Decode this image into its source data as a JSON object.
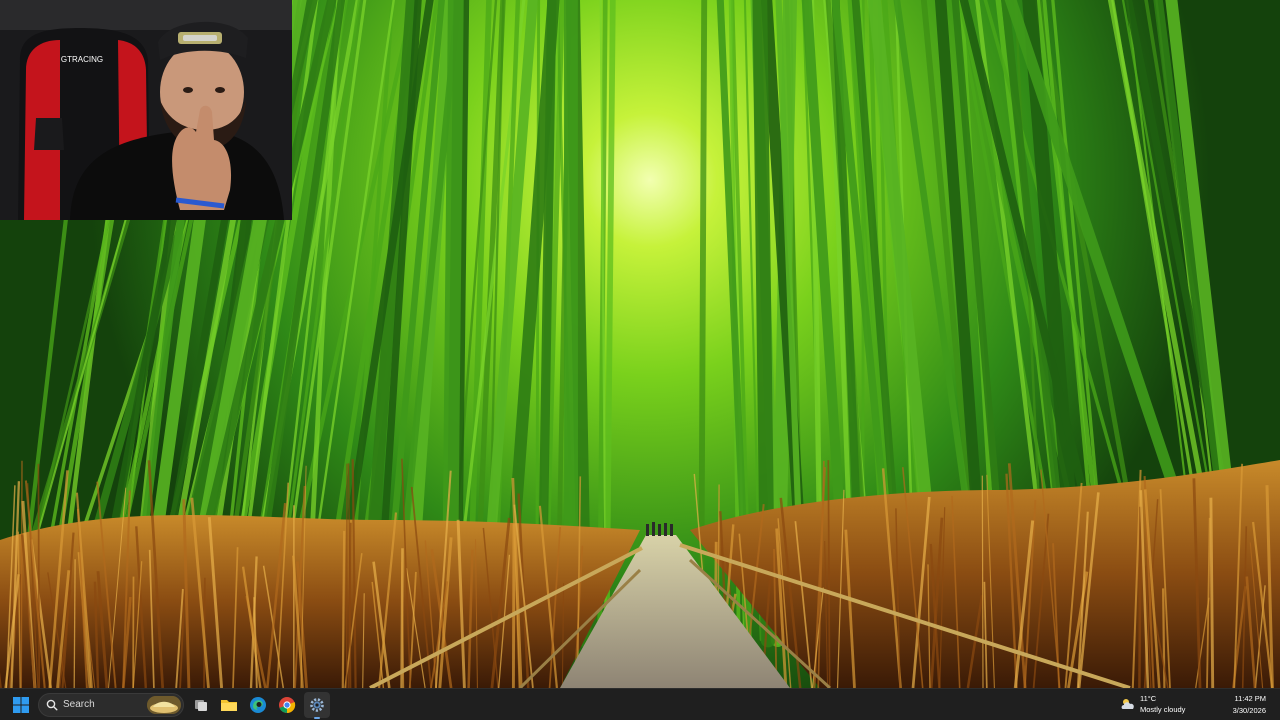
{
  "taskbar": {
    "search_label": "Search",
    "pinned_apps": [
      {
        "name": "Task View"
      },
      {
        "name": "File Explorer"
      },
      {
        "name": "Microsoft Edge"
      },
      {
        "name": "Google Chrome"
      },
      {
        "name": "Settings"
      }
    ],
    "weather": {
      "temperature": "11°C",
      "condition": "Mostly cloudy",
      "icon": "cloud-icon"
    },
    "clock": {
      "time": "11:42 PM",
      "date": "3/30/2026"
    }
  },
  "webcam_overlay": {
    "chair_brand": "GTRACING"
  },
  "colors": {
    "taskbar_bg": "#1f1f1f",
    "bamboo_light": "#7ee11a",
    "bamboo_dark": "#1f6a14",
    "grass": "#a8641c",
    "path": "#a89a80"
  }
}
